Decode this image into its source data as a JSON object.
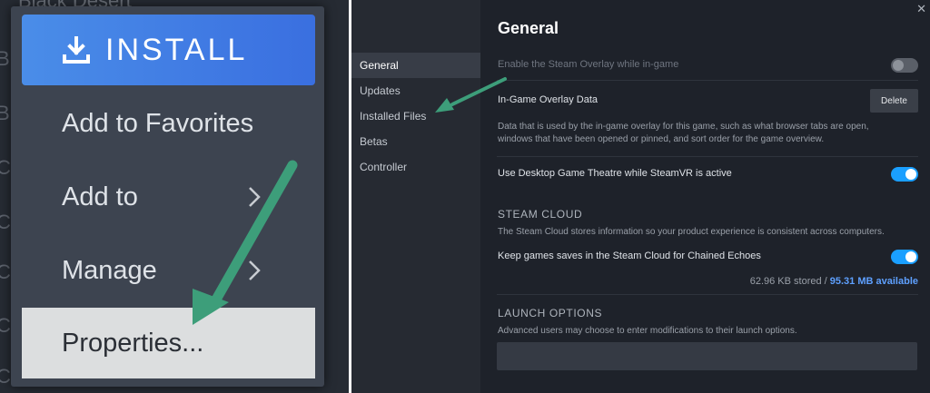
{
  "left": {
    "background_list": {
      "title": "Black Desert",
      "items": [
        "Bl",
        "Br",
        "Ca",
        "Ca",
        "Cl",
        "Co",
        "Co"
      ]
    },
    "menu": {
      "install": {
        "icon": "download-icon",
        "label": "INSTALL"
      },
      "items": [
        {
          "label": "Add to Favorites",
          "has_submenu": false
        },
        {
          "label": "Add to",
          "has_submenu": true
        },
        {
          "label": "Manage",
          "has_submenu": true
        },
        {
          "label": "Properties...",
          "has_submenu": false,
          "highlighted": true
        }
      ]
    }
  },
  "right": {
    "close_icon": "close-icon",
    "sidebar": {
      "items": [
        "General",
        "Updates",
        "Installed Files",
        "Betas",
        "Controller"
      ],
      "active": "General"
    },
    "general": {
      "title": "General",
      "overlay_toggle_label": "Enable the Steam Overlay while in-game",
      "overlay_toggle_on": false,
      "overlay_data_label": "In-Game Overlay Data",
      "delete_label": "Delete",
      "overlay_data_desc": "Data that is used by the in-game overlay for this game, such as what browser tabs are open, windows that have been opened or pinned, and sort order for the game overview.",
      "theatre_label": "Use Desktop Game Theatre while SteamVR is active",
      "theatre_on": true,
      "cloud": {
        "title": "STEAM CLOUD",
        "desc": "The Steam Cloud stores information so your product experience is consistent across computers.",
        "toggle_label": "Keep games saves in the Steam Cloud for Chained Echoes",
        "toggle_on": true,
        "stored": "62.96 KB stored",
        "separator": " / ",
        "available": "95.31 MB available"
      },
      "launch": {
        "title": "LAUNCH OPTIONS",
        "desc": "Advanced users may choose to enter modifications to their launch options.",
        "value": ""
      }
    }
  },
  "colors": {
    "accent_blue": "#1a9fff",
    "install_blue": "#3a6fe0",
    "arrow_green": "#3d9e7a"
  }
}
